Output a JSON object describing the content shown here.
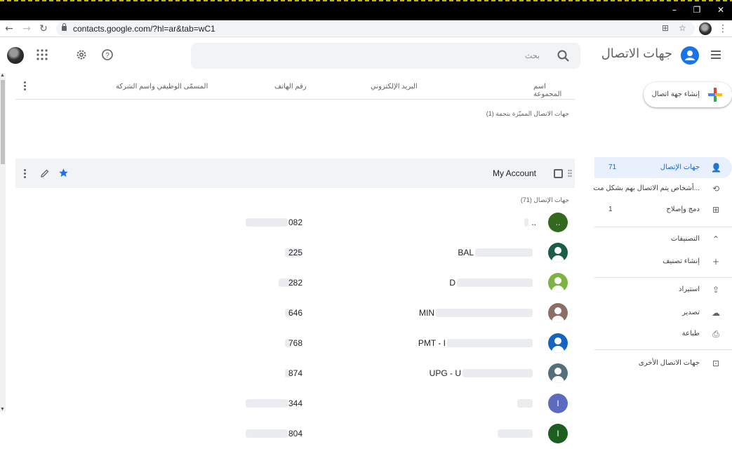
{
  "browser": {
    "url": "contacts.google.com/?hl=ar&tab=wC1",
    "window_controls": [
      "–",
      "❐",
      "✕"
    ]
  },
  "header": {
    "app_title": "جهات الاتصال",
    "search_placeholder": "بحث"
  },
  "sidebar": {
    "create_label": "إنشاء جهة اتصال",
    "items": [
      {
        "label": "جهات الإتصال",
        "count": "71",
        "icon": "person-icon",
        "glyph": "👤"
      },
      {
        "label": "أشخاص يتم الاتصال بهم بشكل مت...",
        "count": "",
        "icon": "history-icon",
        "glyph": "⟲"
      },
      {
        "label": "دمج وإصلاح",
        "count": "1",
        "icon": "merge-icon",
        "glyph": "⊞"
      },
      {
        "label": "التصنيفات",
        "count": "",
        "icon": "chevron-up-icon",
        "glyph": "⌃"
      },
      {
        "label": "إنشاء تصنيف",
        "count": "",
        "icon": "plus-icon",
        "glyph": "+"
      },
      {
        "label": "استيراد",
        "count": "",
        "icon": "upload-icon",
        "glyph": "⇪"
      },
      {
        "label": "تصدير",
        "count": "",
        "icon": "cloud-download-icon",
        "glyph": "☁"
      },
      {
        "label": "طباعة",
        "count": "",
        "icon": "print-icon",
        "glyph": "⎙"
      },
      {
        "label": "جهات الاتصال الأخرى",
        "count": "",
        "icon": "archive-icon",
        "glyph": "⊡"
      }
    ]
  },
  "table": {
    "columns": {
      "group": "اسم المجموعة",
      "email": "البريد الإلكتروني",
      "phone": "رقم الهاتف",
      "job": "المسمّى الوظيفي واسم الشركة"
    },
    "starred_header": "جهات الاتصال المميّزة بنجمة (1)",
    "contacts_header": "جهات الإتصال (71)",
    "starred_contact": "My Account",
    "rows": [
      {
        "name": "..",
        "phone": "082",
        "avatar_color": "#33691e",
        "avatar_text": "..",
        "avatar_type": "letter"
      },
      {
        "name": "BAL",
        "phone": "225",
        "avatar_color": "#1b5e45",
        "avatar_text": "",
        "avatar_type": "person"
      },
      {
        "name": "D",
        "phone": "282",
        "avatar_color": "#7cb342",
        "avatar_text": "",
        "avatar_type": "person"
      },
      {
        "name": "MIN",
        "phone": "646",
        "avatar_color": "#8d6e63",
        "avatar_text": "",
        "avatar_type": "person"
      },
      {
        "name": "PMT - I",
        "phone": "768",
        "avatar_color": "#1565c0",
        "avatar_text": "",
        "avatar_type": "person"
      },
      {
        "name": "UPG - U",
        "phone": "874",
        "avatar_color": "#546e7a",
        "avatar_text": "",
        "avatar_type": "person"
      },
      {
        "name": "",
        "phone": "344",
        "avatar_color": "#5c6bc0",
        "avatar_text": "I",
        "avatar_type": "letter"
      },
      {
        "name": "",
        "phone": "804",
        "avatar_color": "#1b5e20",
        "avatar_text": "I",
        "avatar_type": "letter"
      }
    ]
  },
  "colors": {
    "accent": "#1a73e8",
    "active_bg": "#e8f0fe"
  }
}
